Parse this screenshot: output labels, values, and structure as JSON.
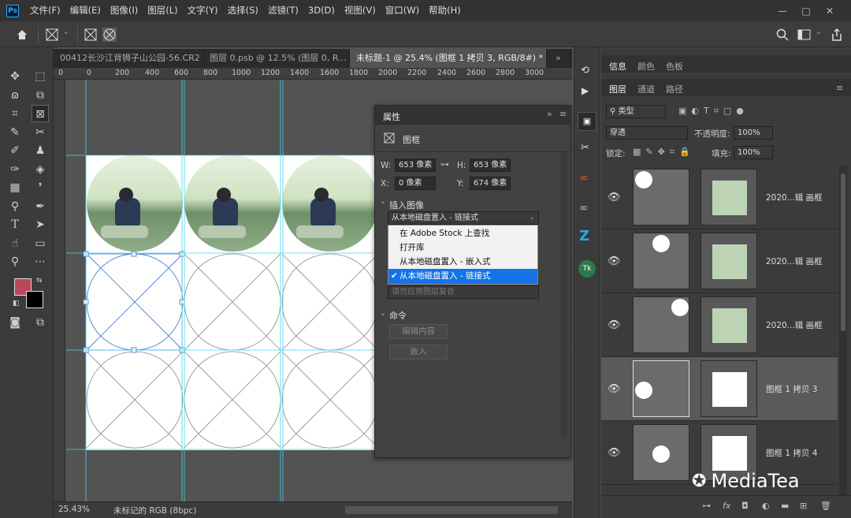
{
  "app": {
    "logo": "Ps"
  },
  "menu": [
    "文件(F)",
    "编辑(E)",
    "图像(I)",
    "图层(L)",
    "文字(Y)",
    "选择(S)",
    "滤镜(T)",
    "3D(D)",
    "视图(V)",
    "窗口(W)",
    "帮助(H)"
  ],
  "window_controls": {
    "minimize": "—",
    "maximize": "□",
    "close": "✕"
  },
  "tabs": [
    {
      "label": "00412长沙江背狮子山公园-56.CR2",
      "active": false
    },
    {
      "label": "图层 0.psb @ 12.5% (图层 0, R...",
      "active": false,
      "close": "×"
    },
    {
      "label": "未标题-1 @ 25.4% (图框 1 拷贝 3, RGB/8#) *",
      "active": true,
      "close": "×"
    }
  ],
  "tab_overflow": "»",
  "ruler_h": [
    "0",
    "0",
    "200",
    "400",
    "600",
    "800",
    "1000",
    "1200",
    "1400",
    "1600",
    "1800",
    "2000",
    "2200",
    "2400",
    "2600",
    "2800",
    "3000"
  ],
  "status": {
    "zoom": "25.43%",
    "profile": "未标记的 RGB (8bpc)"
  },
  "properties": {
    "title": "属性",
    "type_label": "图框",
    "w_label": "W:",
    "w_value": "653 像素",
    "h_label": "H:",
    "h_value": "653 像素",
    "x_label": "X:",
    "x_value": "0 像素",
    "y_label": "Y:",
    "y_value": "674 像素",
    "insert_section": "插入图像",
    "insert_select": "从本地磁盘置入 - 链接式",
    "dropdown": [
      {
        "label": "在 Adobe Stock 上查找",
        "selected": false
      },
      {
        "label": "打开库",
        "selected": false
      },
      {
        "label": "从本地磁盘置入 - 嵌入式",
        "selected": false
      },
      {
        "label": "从本地磁盘置入 - 链接式",
        "selected": true
      }
    ],
    "blend_placeholder": "请勿应用图层复合",
    "commands_section": "命令",
    "edit_btn": "编辑内容",
    "embed_btn": "嵌入"
  },
  "right_panel": {
    "top_tabs": [
      "信息",
      "颜色",
      "色板"
    ],
    "layer_tabs": [
      "图层",
      "通道",
      "路径"
    ],
    "filter_label": "类型",
    "blend_mode": "穿透",
    "opacity_label": "不透明度:",
    "opacity": "100%",
    "lock_label": "锁定:",
    "fill_label": "填充:",
    "fill": "100%",
    "layers": [
      {
        "name": "2020...辑 画框",
        "selected": false
      },
      {
        "name": "2020...辑 画框",
        "selected": false
      },
      {
        "name": "2020...辑 画框",
        "selected": false
      },
      {
        "name": "图框 1 拷贝 3",
        "selected": true
      },
      {
        "name": "图框 1 拷贝 4",
        "selected": false
      }
    ],
    "bottom_icons": [
      "link-icon",
      "fx-icon",
      "mask-icon",
      "adjustment-icon",
      "folder-icon",
      "new-layer-icon",
      "trash-icon"
    ]
  },
  "watermark": "MediaTea"
}
